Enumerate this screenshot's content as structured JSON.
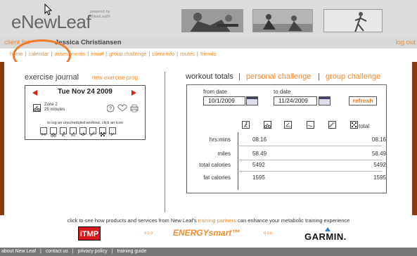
{
  "header": {
    "logo": "eNewLeaf",
    "powered_line1": "powered by",
    "powered_line2": "eNewLeaf®"
  },
  "user": {
    "client_list": "client list",
    "client_name": "Jessica Christiansen",
    "logout": "log out"
  },
  "nav": {
    "items": [
      "home",
      "calendar",
      "assessments",
      "email",
      "group challenge",
      "client info",
      "routes",
      "friends"
    ]
  },
  "journal": {
    "title": "exercise journal",
    "new_link": "new exercise prog.",
    "date": "Tue Nov 24 2009",
    "zone_line1": "Zone 2",
    "zone_line2": "25 minutes",
    "hint": "to log an unscheduled workout, click an icon"
  },
  "workout": {
    "tabs": [
      "workout totals",
      "personal challenge",
      "group challenge"
    ],
    "from_label": "from date",
    "from_value": "10/1/2009",
    "to_label": "to date",
    "to_value": "11/24/2009",
    "refresh": "refresh",
    "total_label": "total",
    "rows": [
      {
        "label": "hrs:mins",
        "value": "08:16",
        "total": "08:16"
      },
      {
        "label": "miles",
        "value": "58.49",
        "total": "58.49"
      },
      {
        "label": "total calories",
        "value": "5492",
        "total": "5492"
      },
      {
        "label": "fat calories",
        "value": "1595",
        "total": "1595"
      }
    ]
  },
  "promo": {
    "text_before": "click to see how products and services from New Leaf's ",
    "link": "training partners",
    "text_after": " can enhance your metabolic training experience",
    "itmp": "iTMP",
    "energy": "ENERGYsmart™",
    "garmin": "GARMIN.",
    "dots": "ooo"
  },
  "footer": {
    "items": [
      "about New Leaf",
      "contact us",
      "privacy policy",
      "training guide"
    ]
  },
  "colors": {
    "accent": "#f28a2e",
    "highlight_circle": "#f07a2a",
    "border_brown": "#8a3a10",
    "arrow_red": "#d62a10"
  }
}
